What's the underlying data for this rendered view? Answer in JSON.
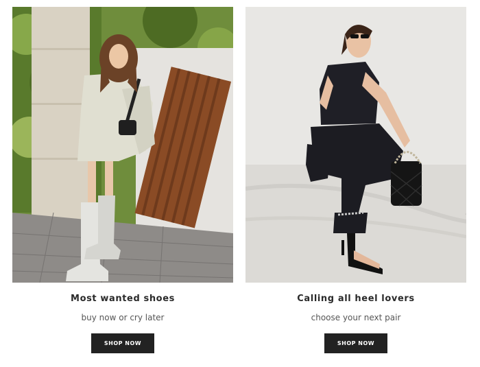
{
  "promos": [
    {
      "title": "Most wanted shoes",
      "subtitle": "buy now or cry later",
      "button_label": "SHOP NOW"
    },
    {
      "title": "Calling all heel lovers",
      "subtitle": "choose your next pair",
      "button_label": "SHOP NOW"
    }
  ]
}
